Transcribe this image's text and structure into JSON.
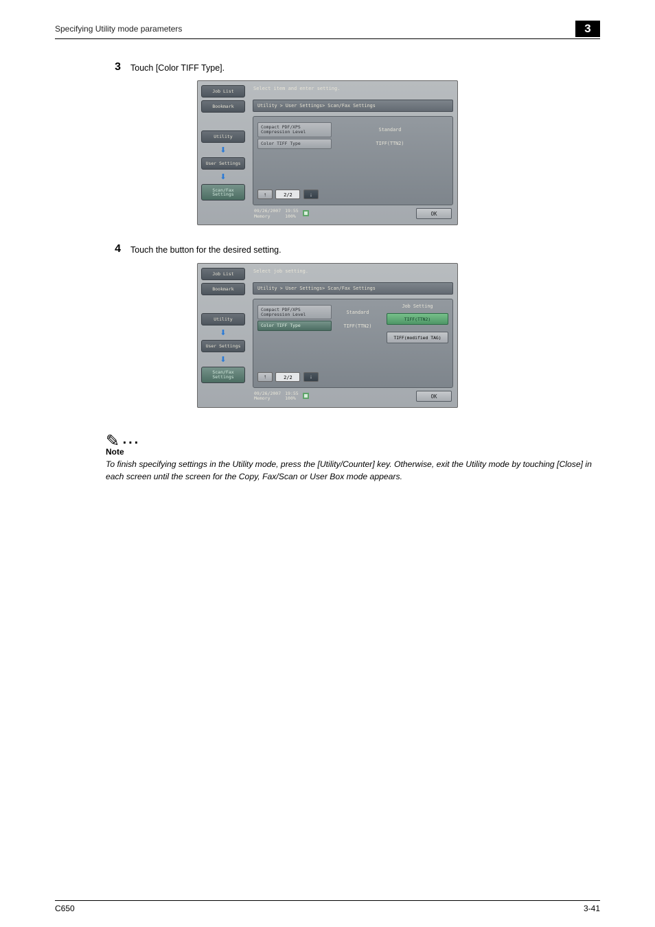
{
  "header": {
    "section_title": "Specifying Utility mode parameters",
    "chapter": "3"
  },
  "steps": [
    {
      "num": "3",
      "text": "Touch [Color TIFF Type]."
    },
    {
      "num": "4",
      "text": "Touch the button for the desired setting."
    }
  ],
  "screen1": {
    "msg": "Select item and enter setting.",
    "breadcrumb": "Utility > User Settings> Scan/Fax Settings",
    "left_tabs": {
      "job_list": "Job List",
      "bookmark": "Bookmark",
      "utility": "Utility",
      "user_settings": "User Settings",
      "scanfax": "Scan/Fax\nSettings"
    },
    "rows": [
      {
        "label": "Compact PDF/XPS\nCompression Level",
        "value": "Standard"
      },
      {
        "label": "Color TIFF Type",
        "value": "TIFF(TTN2)"
      }
    ],
    "pager": "2/2",
    "status": {
      "date": "09/26/2007",
      "time": "19:55",
      "memory_label": "Memory",
      "memory_val": "100%"
    },
    "ok": "OK"
  },
  "screen2": {
    "msg": "Select job setting.",
    "breadcrumb": "Utility > User Settings> Scan/Fax Settings",
    "left_tabs": {
      "job_list": "Job List",
      "bookmark": "Bookmark",
      "utility": "Utility",
      "user_settings": "User Settings",
      "scanfax": "Scan/Fax\nSettings"
    },
    "rows": [
      {
        "label": "Compact PDF/XPS\nCompression Level",
        "value": "Standard"
      },
      {
        "label": "Color TIFF Type",
        "value": "TIFF(TTN2)"
      }
    ],
    "options": {
      "title": "Job Setting",
      "items": [
        "TIFF(TTN2)",
        "TIFF(modified TAG)"
      ]
    },
    "pager": "2/2",
    "status": {
      "date": "09/26/2007",
      "time": "19:55",
      "memory_label": "Memory",
      "memory_val": "100%"
    },
    "ok": "OK"
  },
  "note": {
    "icon": "✎",
    "dots": "...",
    "label": "Note",
    "body": "To finish specifying settings in the Utility mode, press the [Utility/Counter] key. Otherwise, exit the Utility mode by touching [Close] in each screen until the screen for the Copy, Fax/Scan or User Box mode appears."
  },
  "footer": {
    "left": "C650",
    "right": "3-41"
  }
}
